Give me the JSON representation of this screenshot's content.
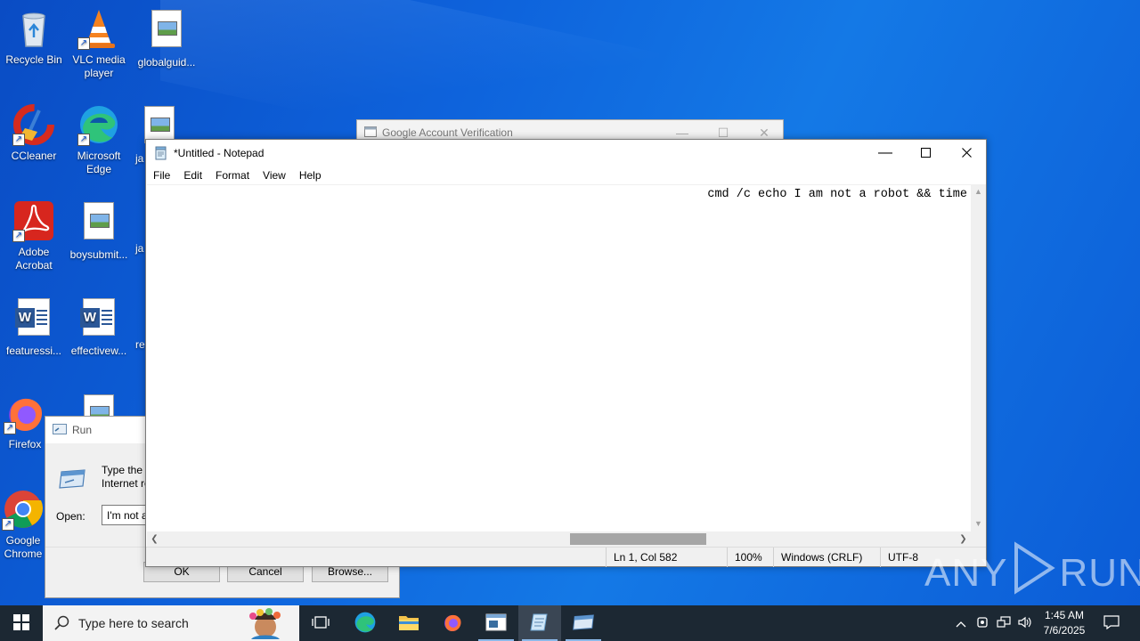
{
  "desktop": {
    "icons": [
      {
        "label": "Recycle Bin"
      },
      {
        "label": "VLC media player"
      },
      {
        "label": "globalguid..."
      },
      {
        "label": "CCleaner"
      },
      {
        "label": "Microsoft Edge"
      },
      {
        "label": "ja"
      },
      {
        "label": "Adobe Acrobat"
      },
      {
        "label": "boysubmit..."
      },
      {
        "label": "ja"
      },
      {
        "label": "featuressi..."
      },
      {
        "label": "effectivew..."
      },
      {
        "label": "re"
      },
      {
        "label": "Firefox"
      },
      {
        "label": "Google Chrome"
      }
    ]
  },
  "google_window": {
    "title": "Google Account Verification"
  },
  "run_dialog": {
    "title": "Run",
    "description": "Type the name of a program, folder, document, or Internet resource, and Windows will open it for you.",
    "open_label": "Open:",
    "input_value": "I'm not a robot",
    "ok_label": "OK",
    "cancel_label": "Cancel",
    "browse_label": "Browse..."
  },
  "notepad": {
    "title": "*Untitled - Notepad",
    "menu": [
      "File",
      "Edit",
      "Format",
      "View",
      "Help"
    ],
    "content": "cmd /c echo I am not a robot && time",
    "status": {
      "position": "Ln 1, Col 582",
      "zoom": "100%",
      "line_ending": "Windows (CRLF)",
      "encoding": "UTF-8"
    },
    "hscroll_position": 0.62
  },
  "taskbar": {
    "search_placeholder": "Type here to search",
    "time": "1:45 AM",
    "date": "7/6/2025"
  },
  "watermark": {
    "text_left": "ANY",
    "text_right": "RUN"
  },
  "colors": {
    "desktop_blue": "#0e63dc",
    "taskbar": "#1c2833"
  }
}
